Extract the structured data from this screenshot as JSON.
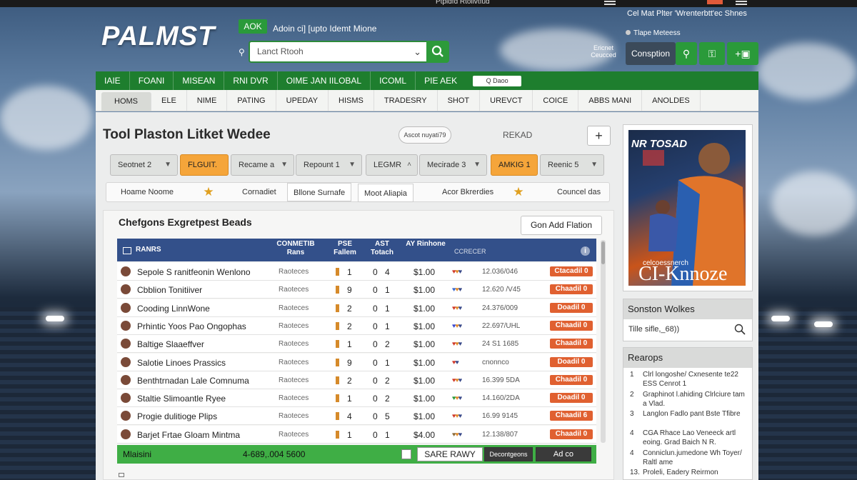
{
  "topbar": {
    "title": "Ptpidfd Rtolivtfud"
  },
  "brand": {
    "logo": "PALMST",
    "badge": "AOK",
    "tagline": "Adoin ci] [upto Idemt Mione"
  },
  "search": {
    "placeholder": "Lanct Rtooh"
  },
  "user": {
    "line": "Cel Mat Plter 'Wrenterbtt'ec Shnes",
    "sub": "Tlape Meteess",
    "label": "Ericnet Ceucced",
    "primary_button": "Consption"
  },
  "nav_primary": {
    "items": [
      "IAIE",
      "FOANI",
      "MISEAN",
      "RNI DVR",
      "OIME JAN IILOBAL",
      "ICOML",
      "PIE AEK"
    ],
    "mini_badge": "Q  Daoo"
  },
  "nav_tabs": [
    "HOMS",
    "ELE",
    "NIME",
    "PATING",
    "UPEDAY",
    "HISMS",
    "TRADESRY",
    "SHOT",
    "UREVCT",
    "COICE",
    "ABBS MANI",
    "ANOLDES"
  ],
  "page": {
    "title": "Tool Plaston Litket Wedee",
    "pill": "Ascot nuyati79",
    "reload": "REKAD",
    "add": "+"
  },
  "filters": [
    {
      "label": "Seotnet 2",
      "style": "gray"
    },
    {
      "label": "FLGUIT.",
      "style": "orange"
    },
    {
      "label": "Recame a",
      "style": "gray"
    },
    {
      "label": "Repount 1",
      "style": "gray"
    },
    {
      "label": "LEGMR",
      "style": "gray"
    },
    {
      "label": "Mecirade 3",
      "style": "gray"
    },
    {
      "label": "AMKIG 1",
      "style": "orange"
    },
    {
      "label": "Reenic 5",
      "style": "gray"
    }
  ],
  "quick": [
    "Hoame Noome",
    "Cornadiet",
    "Bllone Surnafe",
    "Moot Aliapia",
    "Acor Bkrerdies",
    "Councel das"
  ],
  "card": {
    "title": "Chefgons Exgretpest Beads",
    "button": "Gon Add Flation"
  },
  "table": {
    "headers": [
      "RANRS",
      "CONMETIB Rans",
      "PSE Fallem",
      "AST Totach",
      "AY Rinhone",
      "CCRECER"
    ],
    "rows": [
      {
        "name": "Sepole S ranitfeonin Wenlono",
        "role": "Raoteces",
        "p": "1",
        "a": "0",
        "b": "4",
        "price": "$1.00",
        "dots": [
          "#d03a2a",
          "#e08a2a",
          "#3a4a8a"
        ],
        "code": "12.036/046",
        "action": "Ctacadil 0"
      },
      {
        "name": "Cbblion Tonitiiver",
        "role": "Raoteces",
        "p": "9",
        "a": "0",
        "b": "1",
        "price": "$1.00",
        "dots": [
          "#3a6ad0",
          "#e08a2a",
          "#3a4a8a"
        ],
        "code": "12.620 /V45",
        "action": "Chaadil 0"
      },
      {
        "name": "Cooding LinnWone",
        "role": "Raoteces",
        "p": "2",
        "a": "0",
        "b": "1",
        "price": "$1.00",
        "dots": [
          "#d03a2a",
          "#e08a2a",
          "#3a4a8a"
        ],
        "code": "24.376/009",
        "action": "Doadil 0"
      },
      {
        "name": "Prhintic Yoos Pao Ongophas",
        "role": "Raoteces",
        "p": "2",
        "a": "0",
        "b": "1",
        "price": "$1.00",
        "dots": [
          "#3a4ad0",
          "#e08a2a",
          "#3a4a8a"
        ],
        "code": "22.697/UHL",
        "action": "Chaadil 0"
      },
      {
        "name": "Baltige Slaaeffver",
        "role": "Raoteces",
        "p": "1",
        "a": "0",
        "b": "2",
        "price": "$1.00",
        "dots": [
          "#d03a2a",
          "#e08a2a",
          "#3a4a8a"
        ],
        "code": "24 S1 1685",
        "action": "Chaadil 0"
      },
      {
        "name": "Salotie Linoes Prassics",
        "role": "Raoteces",
        "p": "9",
        "a": "0",
        "b": "1",
        "price": "$1.00",
        "dots": [
          "#d03a2a",
          "#3a4a8a"
        ],
        "code": "cnonnco",
        "action": "Doadil 0"
      },
      {
        "name": "Benthtrnadan Lale Comnuma",
        "role": "Raoteces",
        "p": "2",
        "a": "0",
        "b": "2",
        "price": "$1.00",
        "dots": [
          "#d03a2a",
          "#e08a2a",
          "#3a4a8a"
        ],
        "code": "16.399 5DA",
        "action": "Chaadil 0"
      },
      {
        "name": "Staltie Slimoantle Ryee",
        "role": "Raoteces",
        "p": "1",
        "a": "0",
        "b": "2",
        "price": "$1.00",
        "dots": [
          "#2a9a3a",
          "#e08a2a",
          "#3a4a8a"
        ],
        "code": "14.160/2DA",
        "action": "Doadil 0"
      },
      {
        "name": "Progie dulitioge Plips",
        "role": "Raoteces",
        "p": "4",
        "a": "0",
        "b": "5",
        "price": "$1.00",
        "dots": [
          "#d03a2a",
          "#e08a2a",
          "#3a4a8a"
        ],
        "code": "16.99 9145",
        "action": "Chaadil 6"
      },
      {
        "name": "Barjet Frtae Gloam Mintma",
        "role": "Raoteces",
        "p": "1",
        "a": "0",
        "b": "1",
        "price": "$4.00",
        "dots": [
          "#8a6a3a",
          "#e08a2a",
          "#3a4a8a"
        ],
        "code": "12.138/807",
        "action": "Chaadil 0"
      }
    ],
    "footer": {
      "label": "Mlaisini",
      "sum": "4-689,.004 5600",
      "save": "SARE RAWY",
      "b2": "Decontgeons",
      "b3": "Ad co"
    }
  },
  "promo": {
    "title": "NR TOSAD",
    "sub": "celcoessnerch",
    "big": "CI-Knnoze"
  },
  "side_search": {
    "title": "Sonston Wolkes",
    "field": "Tille sifle,_68))"
  },
  "side_list": {
    "title": "Rearops",
    "items": [
      {
        "n": "1",
        "t": "Clrl longoshe/ Cxnesente te22 ESS Cenrot 1"
      },
      {
        "n": "2",
        "t": "Graphinot l.ahiding Clrlciure tam a Vlad."
      },
      {
        "n": "3",
        "t": "Langlon Fadlo pant Bste Tfibre"
      },
      {
        "n": "4",
        "t": "CGA Rhace Lao Veneeck artl eoing. Grad Baich N R."
      },
      {
        "n": "4",
        "t": "Conniclun.jumedone Wh Toyer/ Raltl ame"
      },
      {
        "n": "13.",
        "t": "Proleli, Eadery Reirmon"
      }
    ]
  }
}
